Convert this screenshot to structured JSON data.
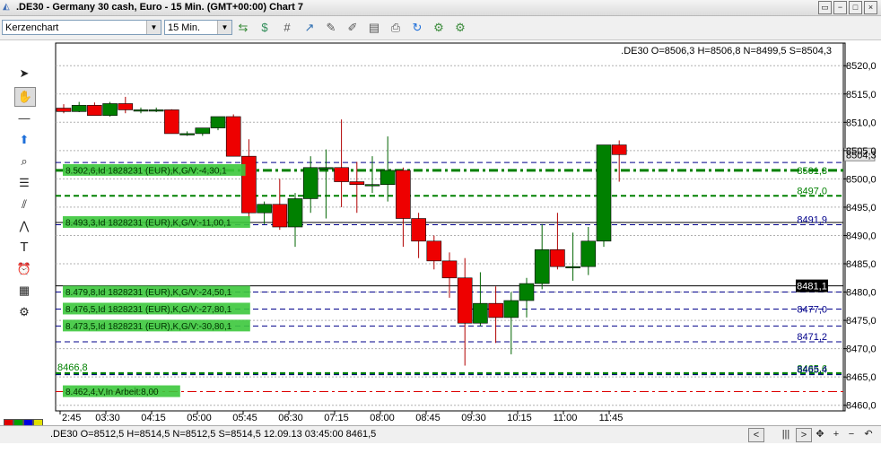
{
  "window": {
    "title": ".DE30 - Germany 30 cash, Euro - 15 Min. (GMT+00:00)   Chart 7",
    "controls": [
      "minimize-icon",
      "restore-icon",
      "maximize-icon",
      "close-icon"
    ]
  },
  "toolbar": {
    "chart_type": "Kerzenchart",
    "timeframe": "15 Min.",
    "icons": [
      "change-icon",
      "money-icon",
      "grid-icon",
      "trend-icon",
      "edit-icon",
      "pen-icon",
      "page-icon",
      "print-icon",
      "refresh-icon",
      "settings-icon",
      "options-icon"
    ]
  },
  "left_tools": [
    "cursor-arrow-icon",
    "hand-icon",
    "line-icon",
    "arrow-up-icon",
    "zoom-icon",
    "fibonacci-icon",
    "fan-icon",
    "wave-icon",
    "text-icon",
    "alarm-icon",
    "calculator-icon",
    "indicator-icon"
  ],
  "color_swatches": [
    "#e00000",
    "#00a000",
    "#0000e0",
    "#e0e000",
    "#ffffff",
    "#c00000",
    "#404040",
    "#800000"
  ],
  "statusbar": {
    "text": ".DE30 O=8512,5 H=8514,5 N=8512,5 S=8514,5   12.09.13 03:45:00 8461,5",
    "buttons": [
      "<",
      "|||",
      ">",
      "✥",
      "+",
      "−",
      "↶"
    ]
  },
  "chart_data": {
    "type": "candlestick",
    "header": ".DE30 O=8506,3 H=8506,8 N=8499,5 S=8504,3",
    "x_ticks": [
      "2:45",
      "03:30",
      "04:15",
      "05:00",
      "05:45",
      "06:30",
      "07:15",
      "08:00",
      "08:45",
      "09:30",
      "10:15",
      "11:00",
      "11:45"
    ],
    "y_ticks": [
      "8520,0",
      "8515,0",
      "8510,0",
      "8505,0",
      "8500,0",
      "8495,0",
      "8490,0",
      "8485,0",
      "8480,0",
      "8475,0",
      "8470,0",
      "8465,0",
      "8460,0"
    ],
    "ylim": [
      8459,
      8524
    ],
    "current_price": "8504,3",
    "candles": [
      {
        "o": 8512.5,
        "h": 8513.2,
        "l": 8511.6,
        "c": 8511.9
      },
      {
        "o": 8511.9,
        "h": 8513.6,
        "l": 8511.8,
        "c": 8513.0
      },
      {
        "o": 8513.0,
        "h": 8513.5,
        "l": 8511.2,
        "c": 8511.2
      },
      {
        "o": 8511.2,
        "h": 8513.6,
        "l": 8511.0,
        "c": 8513.3
      },
      {
        "o": 8513.3,
        "h": 8514.5,
        "l": 8511.6,
        "c": 8512.2
      },
      {
        "o": 8512.2,
        "h": 8512.6,
        "l": 8511.6,
        "c": 8512.2
      },
      {
        "o": 8512.2,
        "h": 8512.6,
        "l": 8511.8,
        "c": 8512.2
      },
      {
        "o": 8512.2,
        "h": 8512.3,
        "l": 8508.0,
        "c": 8508.0
      },
      {
        "o": 8508.0,
        "h": 8508.4,
        "l": 8507.6,
        "c": 8508.0
      },
      {
        "o": 8508.0,
        "h": 8509.0,
        "l": 8507.6,
        "c": 8509.0
      },
      {
        "o": 8509.0,
        "h": 8511.0,
        "l": 8508.6,
        "c": 8511.0
      },
      {
        "o": 8511.0,
        "h": 8511.4,
        "l": 8504.0,
        "c": 8504.0
      },
      {
        "o": 8504.0,
        "h": 8507.0,
        "l": 8493.0,
        "c": 8494.0
      },
      {
        "o": 8494.0,
        "h": 8496.0,
        "l": 8492.0,
        "c": 8495.5
      },
      {
        "o": 8495.5,
        "h": 8500.0,
        "l": 8491.0,
        "c": 8491.5
      },
      {
        "o": 8491.5,
        "h": 8497.5,
        "l": 8488.0,
        "c": 8496.5
      },
      {
        "o": 8496.5,
        "h": 8504.0,
        "l": 8494.0,
        "c": 8502.0
      },
      {
        "o": 8502.0,
        "h": 8505.2,
        "l": 8493.0,
        "c": 8502.0
      },
      {
        "o": 8502.0,
        "h": 8510.5,
        "l": 8495.0,
        "c": 8499.5
      },
      {
        "o": 8499.5,
        "h": 8503.0,
        "l": 8494.0,
        "c": 8499.0
      },
      {
        "o": 8499.0,
        "h": 8504.0,
        "l": 8497.5,
        "c": 8499.0
      },
      {
        "o": 8499.0,
        "h": 8507.5,
        "l": 8496.0,
        "c": 8501.5
      },
      {
        "o": 8501.5,
        "h": 8502.0,
        "l": 8488.0,
        "c": 8493.0
      },
      {
        "o": 8493.0,
        "h": 8494.0,
        "l": 8486.0,
        "c": 8489.0
      },
      {
        "o": 8489.0,
        "h": 8490.0,
        "l": 8484.0,
        "c": 8485.5
      },
      {
        "o": 8485.5,
        "h": 8487.0,
        "l": 8479.0,
        "c": 8482.5
      },
      {
        "o": 8482.5,
        "h": 8486.0,
        "l": 8467.0,
        "c": 8474.5
      },
      {
        "o": 8474.5,
        "h": 8483.5,
        "l": 8474.0,
        "c": 8478.0
      },
      {
        "o": 8478.0,
        "h": 8481.0,
        "l": 8471.0,
        "c": 8475.5
      },
      {
        "o": 8475.5,
        "h": 8480.0,
        "l": 8469.0,
        "c": 8478.5
      },
      {
        "o": 8478.5,
        "h": 8482.5,
        "l": 8475.5,
        "c": 8481.5
      },
      {
        "o": 8481.5,
        "h": 8492.0,
        "l": 8480.5,
        "c": 8487.5
      },
      {
        "o": 8487.5,
        "h": 8494.0,
        "l": 8484.0,
        "c": 8484.5
      },
      {
        "o": 8484.5,
        "h": 8490.5,
        "l": 8482.0,
        "c": 8484.5
      },
      {
        "o": 8484.5,
        "h": 8491.5,
        "l": 8483.0,
        "c": 8489.0
      },
      {
        "o": 8489.0,
        "h": 8506.0,
        "l": 8488.0,
        "c": 8506.0
      },
      {
        "o": 8506.0,
        "h": 8506.8,
        "l": 8499.5,
        "c": 8504.3
      }
    ],
    "orders": [
      {
        "text": "8.502,6,Id 1828231 (EUR),K,G/V:-4,30,1",
        "y": 8501.5,
        "price_label": "8501,3",
        "color": "#008000",
        "style": "dashdot"
      },
      {
        "text": "8.493,3,Id 1828231 (EUR),K,G/V:-11,00,1",
        "y": 8492.3,
        "price_label": "",
        "color": "#000000",
        "style": "solid"
      },
      {
        "text": "8.479,8,Id 1828231 (EUR),K,G/V:-24,50,1",
        "y": 8480.0,
        "price_label": "",
        "color": "#00008b",
        "style": "dash"
      },
      {
        "text": "8.476,5,Id 1828231 (EUR),K,G/V:-27,80,1",
        "y": 8477.0,
        "price_label": "8477,0",
        "color": "#00008b",
        "style": "dash"
      },
      {
        "text": "8.473,5,Id 1828231 (EUR),K,G/V:-30,80,1",
        "y": 8474.0,
        "price_label": "",
        "color": "#00008b",
        "style": "dash"
      },
      {
        "text": "8.462,4,V,In Arbeit:8,00",
        "y": 8462.4,
        "price_label": "",
        "color": "#dd0000",
        "style": "dashdot"
      }
    ],
    "lines": [
      {
        "y": 8497.0,
        "label": "8497,0",
        "color": "#008000",
        "style": "dash",
        "width": 2
      },
      {
        "y": 8491.9,
        "label": "8491,9",
        "color": "#00008b",
        "style": "dash",
        "width": 1
      },
      {
        "y": 8471.2,
        "label": "8471,2",
        "color": "#00008b",
        "style": "dash",
        "width": 1
      },
      {
        "y": 8465.6,
        "label": "8465,6",
        "color": "#008000",
        "style": "dash",
        "width": 3
      },
      {
        "y": 8465.4,
        "label": "8465,4",
        "color": "#00008b",
        "style": "dash",
        "width": 1
      },
      {
        "y": 8481.1,
        "label": "",
        "color": "#000000",
        "style": "solid",
        "width": 1
      },
      {
        "y": 8502.9,
        "label": "",
        "color": "#00008b",
        "style": "dash",
        "width": 1
      }
    ],
    "extra_labels": [
      {
        "text": "8466,8",
        "y": 8466.8,
        "color": "#008000"
      }
    ],
    "crosshair_label": "8481,1",
    "grid": true
  }
}
